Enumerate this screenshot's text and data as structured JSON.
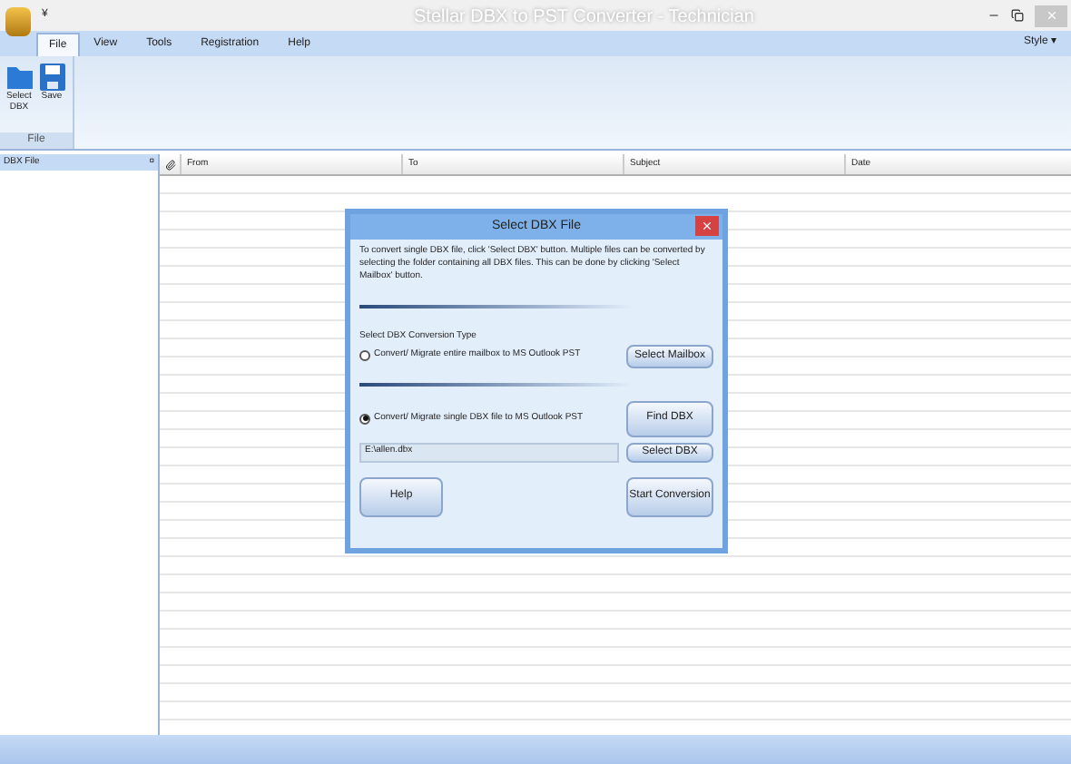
{
  "window": {
    "title": "Stellar DBX to PST Converter - Technician"
  },
  "quick_access": "¥",
  "menu": [
    {
      "label": "File",
      "selected": true
    },
    {
      "label": "View",
      "selected": false
    },
    {
      "label": "Tools",
      "selected": false
    },
    {
      "label": "Registration",
      "selected": false
    },
    {
      "label": "Help",
      "selected": false
    }
  ],
  "style_menu": "Style ▾",
  "ribbon": {
    "group": "File",
    "buttons": [
      {
        "label": "Select DBX",
        "kind": "folder"
      },
      {
        "label": "Save",
        "kind": "disk"
      }
    ]
  },
  "left_panel": {
    "title": "DBX File",
    "pin": "¤"
  },
  "table": {
    "columns": [
      "From",
      "To",
      "Subject",
      "Date"
    ]
  },
  "dialog": {
    "title": "Select DBX File",
    "intro": "To convert single DBX file, click 'Select DBX' button. Multiple files can be converted by selecting the folder containing all DBX files. This can be done by clicking 'Select Mailbox' button.",
    "type_label": "Select DBX Conversion Type",
    "options": [
      {
        "label": "Convert/ Migrate entire mailbox to MS Outlook PST",
        "selected": false,
        "button": "Select Mailbox"
      },
      {
        "label": "Convert/ Migrate single DBX file to MS Outlook PST",
        "selected": true,
        "button": "Find DBX"
      }
    ],
    "path": "E:\\allen.dbx",
    "path_button": "Select DBX",
    "help": "Help",
    "start": "Start Conversion"
  }
}
